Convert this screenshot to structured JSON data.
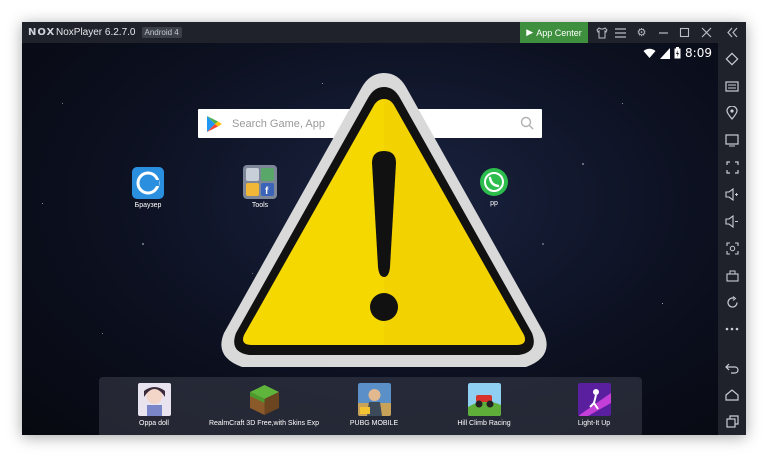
{
  "window": {
    "app_name": "NoxPlayer 6.2.7.0",
    "android_badge": "Android 4",
    "logo": "NOX",
    "app_center_label": "App Center"
  },
  "titlebar_icons": [
    "shirt-icon",
    "menu-icon",
    "gear-icon",
    "minimize-icon",
    "maximize-icon",
    "close-icon",
    "collapse-icon"
  ],
  "status": {
    "time": "8:09"
  },
  "search": {
    "placeholder": "Search Game, App"
  },
  "desktop": {
    "browser_label": "Браузер",
    "tools_label": "Tools",
    "whatsapp_label": "pp"
  },
  "dock": {
    "items": [
      {
        "label": "Oppa doll",
        "icon": "oppa-doll-icon"
      },
      {
        "label": "RealmCraft 3D Free,with Skins Exp",
        "icon": "realmcraft-icon"
      },
      {
        "label": "PUBG MOBILE",
        "icon": "pubg-icon"
      },
      {
        "label": "Hill Climb Racing",
        "icon": "hill-climb-icon"
      },
      {
        "label": "Light-It Up",
        "icon": "light-it-up-icon"
      }
    ]
  },
  "sidebar": [
    "rotate-icon",
    "keyboard-icon",
    "location-icon",
    "screen-icon",
    "fullscreen-icon",
    "volume-up-icon",
    "volume-down-icon",
    "screenshot-icon",
    "apk-install-icon",
    "restart-icon",
    "more-icon",
    "back-icon",
    "home-icon",
    "recent-apps-icon"
  ],
  "colors": {
    "app_center": "#3e8f3e",
    "warning_fill": "#f5d800",
    "warning_border": "#d6d6d6"
  }
}
